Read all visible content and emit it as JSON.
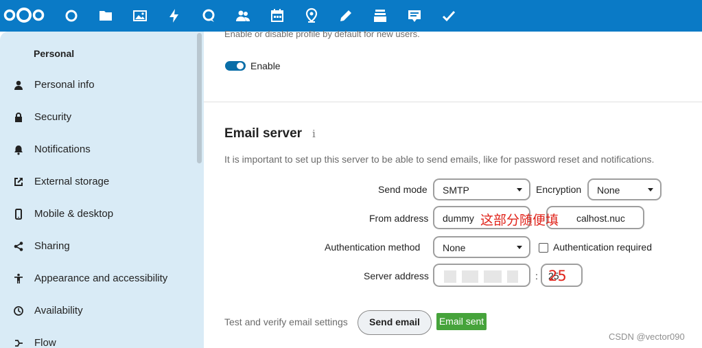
{
  "topbar": {
    "color": "#0a7ac6",
    "apps": [
      "dashboard-icon",
      "files-icon",
      "photos-icon",
      "activity-icon",
      "talk-icon",
      "contacts-icon",
      "calendar-icon",
      "maps-icon",
      "notes-icon",
      "deck-icon",
      "forms-icon",
      "tasks-icon"
    ]
  },
  "sidebar": {
    "title": "Personal",
    "items": [
      {
        "label": "Personal info",
        "icon": "person-icon"
      },
      {
        "label": "Security",
        "icon": "lock-icon"
      },
      {
        "label": "Notifications",
        "icon": "bell-icon"
      },
      {
        "label": "External storage",
        "icon": "external-link-icon"
      },
      {
        "label": "Mobile & desktop",
        "icon": "phone-icon"
      },
      {
        "label": "Sharing",
        "icon": "share-icon"
      },
      {
        "label": "Appearance and accessibility",
        "icon": "accessibility-icon"
      },
      {
        "label": "Availability",
        "icon": "clock-icon"
      },
      {
        "label": "Flow",
        "icon": "flow-icon"
      }
    ]
  },
  "profile": {
    "note": "Enable or disable profile by default for new users.",
    "toggle_label": "Enable"
  },
  "email_server": {
    "title": "Email server",
    "info": "i",
    "description": "It is important to set up this server to be able to send emails, like for password reset and notifications.",
    "send_mode_label": "Send mode",
    "send_mode_value": "SMTP",
    "encryption_label": "Encryption",
    "encryption_value": "None",
    "from_address_label": "From address",
    "from_local": "dummy",
    "from_domain": "calhost.nuc",
    "annotation_from": "这部分随便填",
    "auth_method_label": "Authentication method",
    "auth_method_value": "None",
    "auth_required_label": "Authentication required",
    "server_address_label": "Server address",
    "port_separator": ":",
    "port_value": "25",
    "annotation_port": "25",
    "test_label": "Test and verify email settings",
    "send_button": "Send email",
    "status_badge": "Email sent"
  },
  "watermark": "CSDN @vector090"
}
